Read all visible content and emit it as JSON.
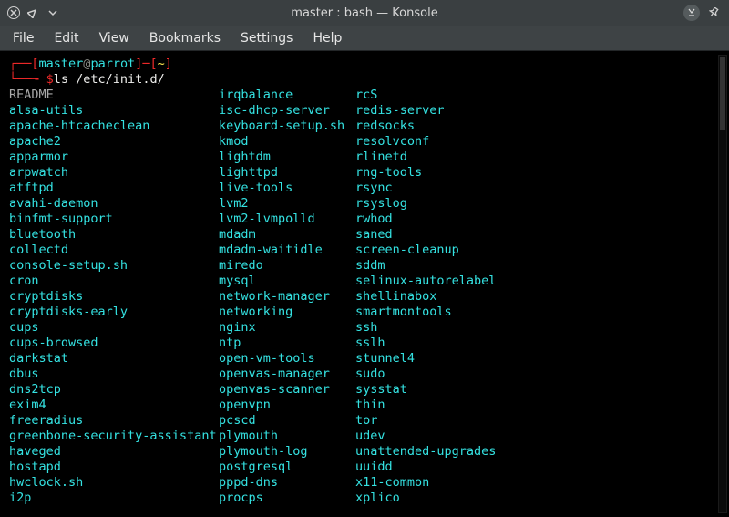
{
  "titlebar": {
    "title": "master : bash — Konsole"
  },
  "menu": {
    "file": "File",
    "edit": "Edit",
    "view": "View",
    "bookmarks": "Bookmarks",
    "settings": "Settings",
    "help": "Help"
  },
  "prompt": {
    "l1_open": "┌──[",
    "user": "master",
    "at": "@",
    "host": "parrot",
    "l1_mid": "]─[",
    "cwd": "~",
    "l1_close": "]",
    "l2_open": "└──╼ ",
    "dollar": "$",
    "cmd": "ls /etc/init.d/"
  },
  "cols": {
    "c1": [
      "README",
      "alsa-utils",
      "apache-htcacheclean",
      "apache2",
      "apparmor",
      "arpwatch",
      "atftpd",
      "avahi-daemon",
      "binfmt-support",
      "bluetooth",
      "collectd",
      "console-setup.sh",
      "cron",
      "cryptdisks",
      "cryptdisks-early",
      "cups",
      "cups-browsed",
      "darkstat",
      "dbus",
      "dns2tcp",
      "exim4",
      "freeradius",
      "greenbone-security-assistant",
      "haveged",
      "hostapd",
      "hwclock.sh",
      "i2p"
    ],
    "c2": [
      "irqbalance",
      "isc-dhcp-server",
      "keyboard-setup.sh",
      "kmod",
      "lightdm",
      "lighttpd",
      "live-tools",
      "lvm2",
      "lvm2-lvmpolld",
      "mdadm",
      "mdadm-waitidle",
      "miredo",
      "mysql",
      "network-manager",
      "networking",
      "nginx",
      "ntp",
      "open-vm-tools",
      "openvas-manager",
      "openvas-scanner",
      "openvpn",
      "pcscd",
      "plymouth",
      "plymouth-log",
      "postgresql",
      "pppd-dns",
      "procps"
    ],
    "c3": [
      "rcS",
      "redis-server",
      "redsocks",
      "resolvconf",
      "rlinetd",
      "rng-tools",
      "rsync",
      "rsyslog",
      "rwhod",
      "saned",
      "screen-cleanup",
      "sddm",
      "selinux-autorelabel",
      "shellinabox",
      "smartmontools",
      "ssh",
      "sslh",
      "stunnel4",
      "sudo",
      "sysstat",
      "thin",
      "tor",
      "udev",
      "unattended-upgrades",
      "uuidd",
      "x11-common",
      "xplico"
    ]
  },
  "plain_entries": [
    "README"
  ]
}
